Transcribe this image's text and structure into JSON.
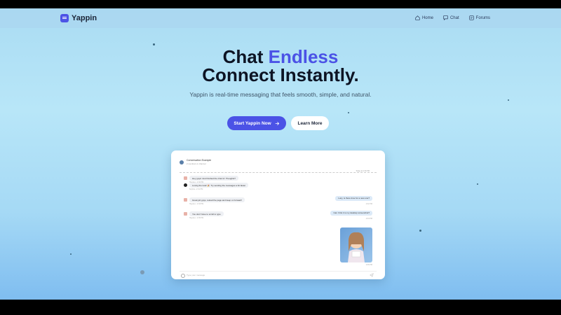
{
  "brand": {
    "name": "Yappin",
    "color": "#4b52e6"
  },
  "nav": {
    "links": [
      {
        "label": "Home",
        "icon": "home-icon"
      },
      {
        "label": "Chat",
        "icon": "chat-icon"
      },
      {
        "label": "Forums",
        "icon": "forums-icon"
      }
    ]
  },
  "hero": {
    "title_prefix": "Chat",
    "title_accent": "Endless",
    "title_line2": "Connect Instantly.",
    "subtitle": "Yappin is real-time messaging that feels smooth, simple, and natural.",
    "primary_cta": "Start Yappin Now",
    "secondary_cta": "Learn More"
  },
  "chat_preview": {
    "channel_title": "Conversation Example",
    "channel_subtitle": "2 members in channel",
    "separator_label": "Today at 2:30 PM",
    "messages": [
      {
        "side": "received",
        "avatar": "avatar-icon",
        "text": "Hey guys! Just finished the chat UI. Thoughts?",
        "meta": "Hayden • 2:30 PM"
      },
      {
        "side": "received",
        "avatar": "avatar-icon",
        "text": "Loving the look! 🎉 Try sending the messages a bit faster",
        "meta": "Sophia • 2:31 PM"
      },
      {
        "side": "sent",
        "text": "Lucy, is there time for a new one?",
        "meta": "2:32 PM"
      },
      {
        "side": "received",
        "avatar": "avatar-icon",
        "text": "Great job guys, reload the page and keep on forward!",
        "meta": "Hayden • 2:33 PM"
      },
      {
        "side": "sent",
        "text": "Can I link it to my desktop screenshot?",
        "meta": "2:34 PM"
      },
      {
        "side": "received",
        "avatar": "avatar-icon",
        "text": "You don't have to scroll to type",
        "meta": "Hayden • 2:35 PM"
      }
    ],
    "image_meta": "2:36 PM",
    "input_placeholder": "Type your message"
  }
}
